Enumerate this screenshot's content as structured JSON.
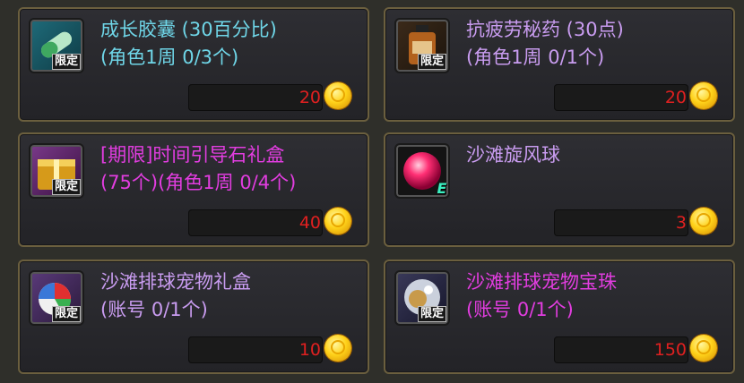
{
  "badge_label": "限定",
  "items": [
    {
      "name_line1": "成长胶囊 (30百分比)",
      "name_line2": "(角色1周 0/3个)",
      "price": "20",
      "icon": "capsule-icon",
      "color": "#6fd6e8",
      "limited": true
    },
    {
      "name_line1": "抗疲劳秘药 (30点)",
      "name_line2": "(角色1周 0/1个)",
      "price": "20",
      "icon": "potion-bottle-icon",
      "color": "#c99cf0",
      "limited": true
    },
    {
      "name_line1": "[期限]时间引导石礼盒",
      "name_line2": "(75个)(角色1周 0/4个)",
      "price": "40",
      "icon": "gift-box-icon",
      "color": "#e23de0",
      "limited": true
    },
    {
      "name_line1": "沙滩旋风球",
      "name_line2": "",
      "price": "3",
      "icon": "beach-ball-icon",
      "color": "#c99cf0",
      "limited": false,
      "tag": "E"
    },
    {
      "name_line1": "沙滩排球宠物礼盒",
      "name_line2": "(账号 0/1个)",
      "price": "10",
      "icon": "volleyball-box-icon",
      "color": "#c99cf0",
      "limited": true
    },
    {
      "name_line1": "沙滩排球宠物宝珠",
      "name_line2": "(账号 0/1个)",
      "price": "150",
      "icon": "pet-orb-icon",
      "color": "#e23de0",
      "limited": true
    }
  ]
}
